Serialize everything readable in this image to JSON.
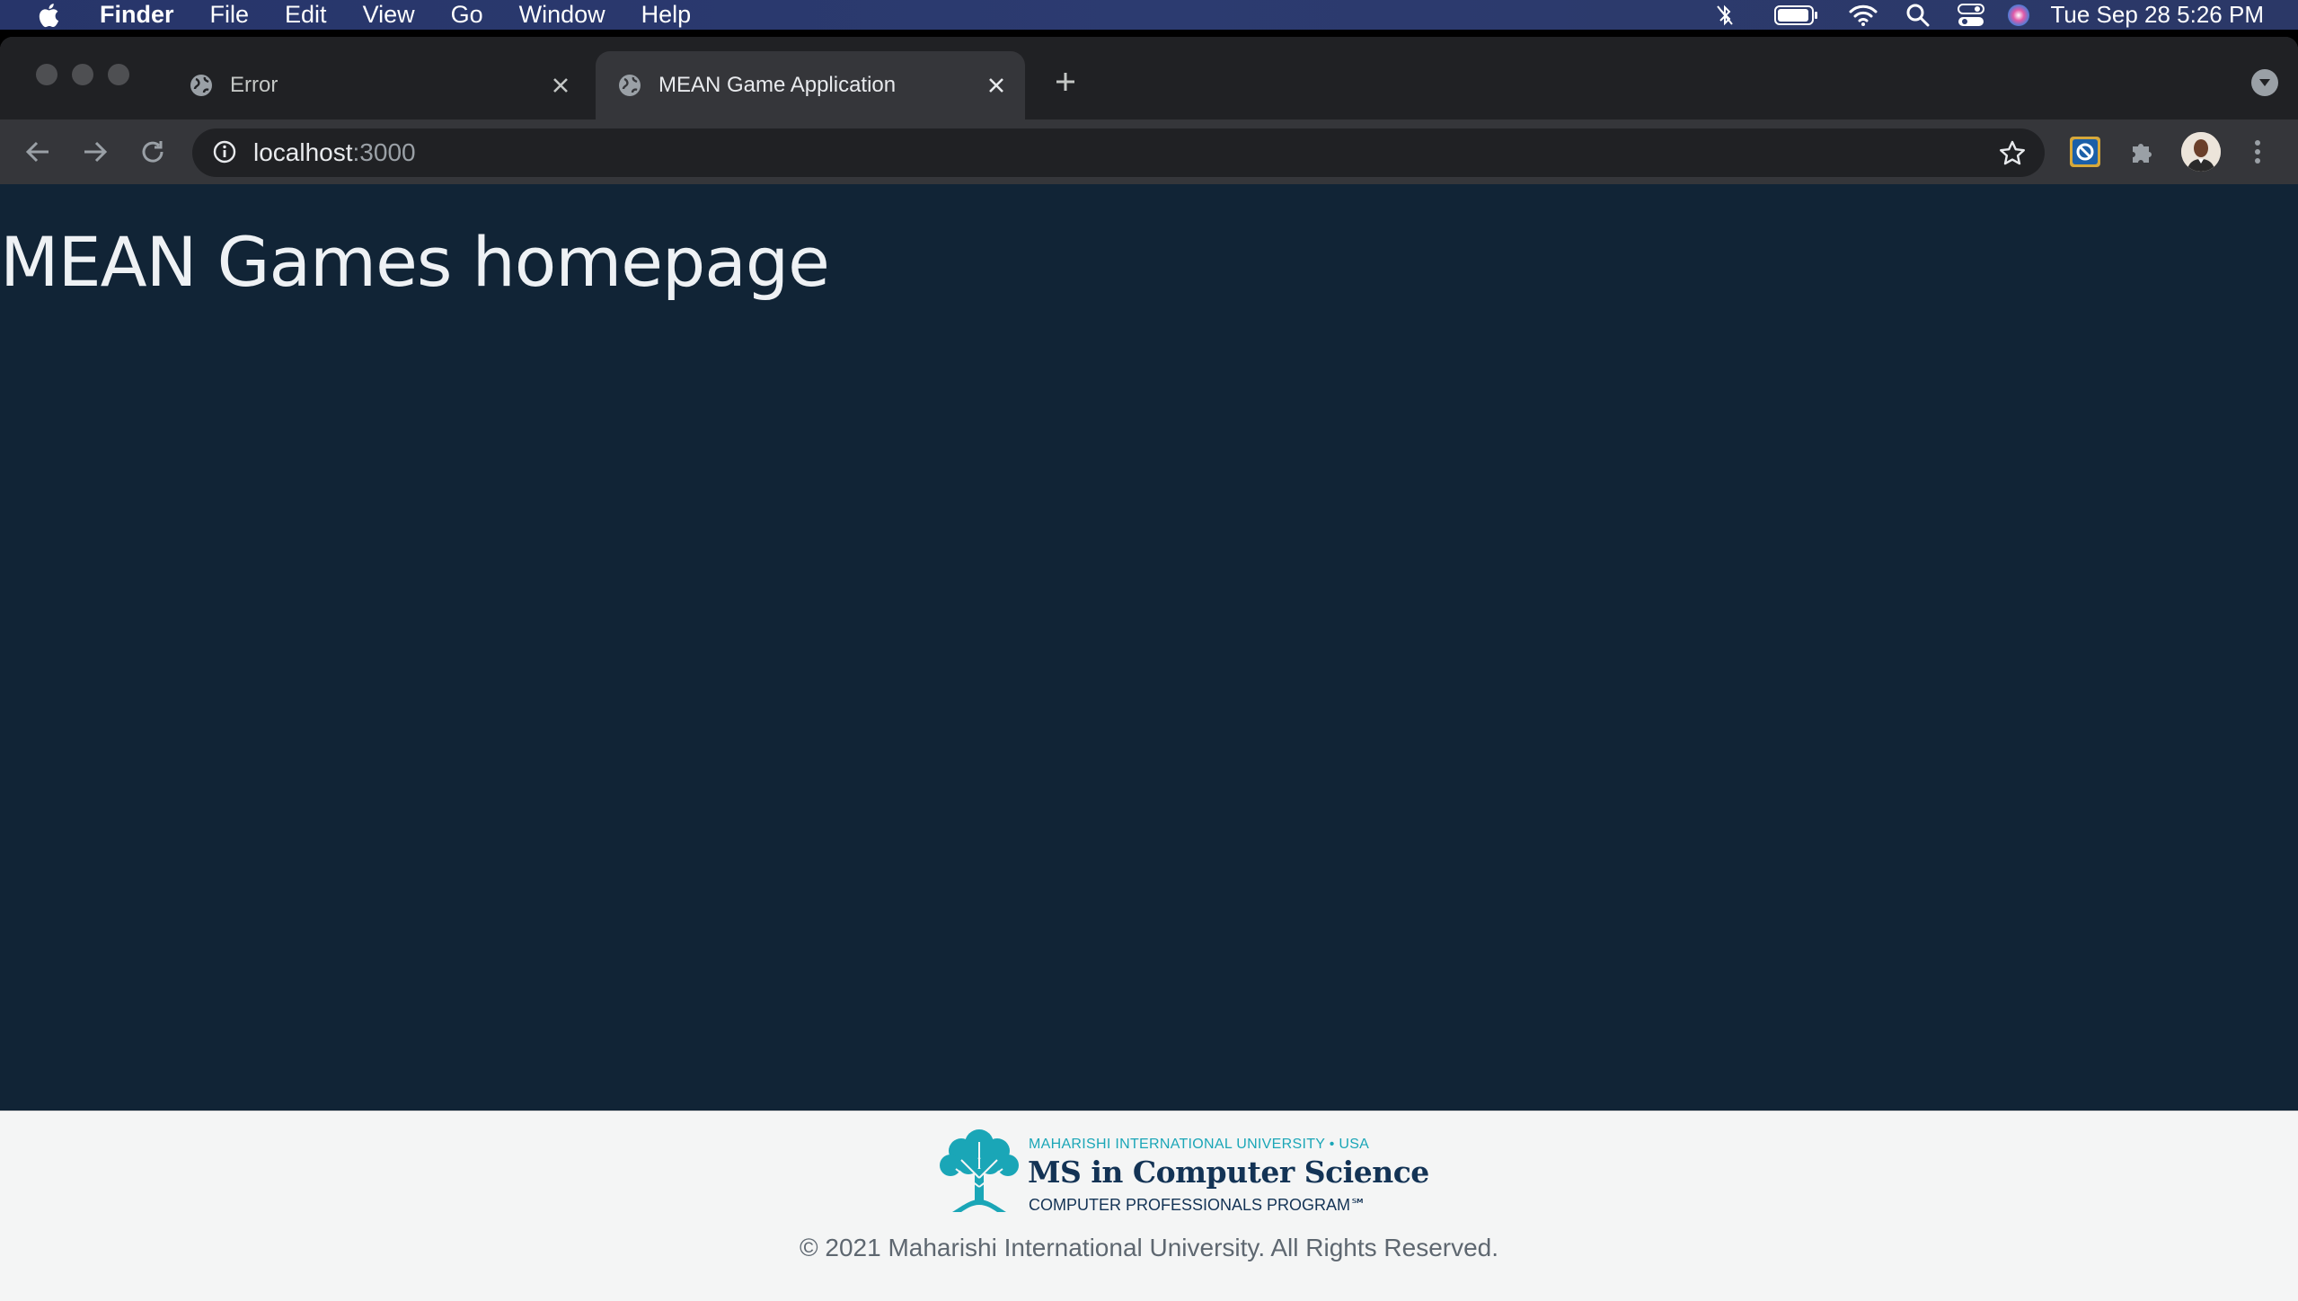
{
  "menubar": {
    "app_name": "Finder",
    "items": [
      "File",
      "Edit",
      "View",
      "Go",
      "Window",
      "Help"
    ],
    "status_icons": [
      "bluetooth-off-icon",
      "battery-icon",
      "wifi-icon",
      "spotlight-search-icon",
      "control-center-icon",
      "siri-icon"
    ],
    "clock": "Tue Sep 28  5:26 PM"
  },
  "browser": {
    "tabs": [
      {
        "title": "Error",
        "icon": "globe-icon",
        "active": false
      },
      {
        "title": "MEAN Game Application",
        "icon": "globe-icon",
        "active": true
      }
    ],
    "address": {
      "host": "localhost",
      "port": ":3000"
    }
  },
  "page": {
    "heading": "MEAN Games homepage",
    "footer": {
      "logo_top": "MAHARISHI INTERNATIONAL UNIVERSITY • USA",
      "logo_main": "MS in Computer Science",
      "logo_sub": "COMPUTER PROFESSIONALS PROGRAM℠",
      "copyright": "© 2021 Maharishi International University. All Rights Reserved."
    }
  },
  "colors": {
    "page_background": "#112436",
    "footer_background": "#f4f5f5",
    "logo_teal": "#1aa6b7",
    "logo_navy": "#133355"
  }
}
